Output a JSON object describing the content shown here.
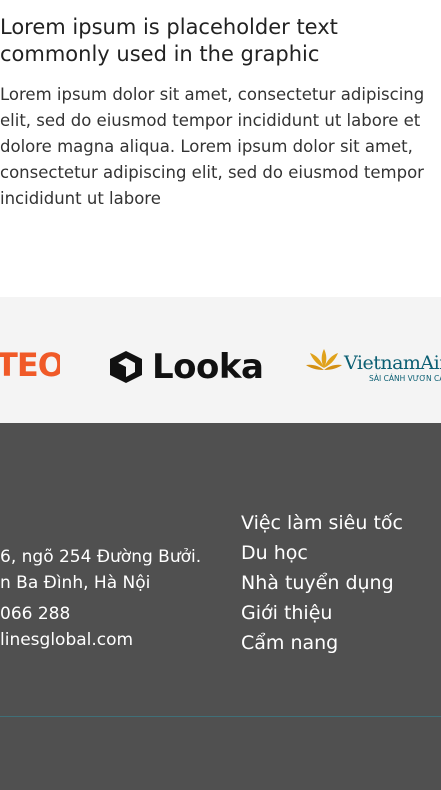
{
  "intro": {
    "title": "Lorem ipsum is placeholder text commonly used in the graphic",
    "body": "Lorem ipsum dolor sit amet, consectetur adipiscing elit, sed do eiusmod tempor incididunt ut labore et dolore magna aliqua. Lorem ipsum dolor sit amet, consectetur adipiscing elit, sed do eiusmod tempor incididunt ut labore"
  },
  "partners": {
    "logos": [
      {
        "name": "TEO",
        "text": "TEO",
        "color": "#f05a28"
      },
      {
        "name": "Looka",
        "text": "Looka",
        "color": "#111111"
      },
      {
        "name": "Vietnam Airlines",
        "text": "VietnamAirlines",
        "subtext": "SÀI CÁNH VƯƠN CAO",
        "color": "#0b5f73",
        "accent": "#e0a21b"
      }
    ]
  },
  "footer": {
    "contact": {
      "address_line1": "6, ngõ 254 Đường Bưởi.",
      "address_line2": "n Ba Đình, Hà Nội",
      "phone": "066 288",
      "email": "linesglobal.com"
    },
    "links": [
      {
        "label": "Việc làm siêu tốc"
      },
      {
        "label": "Du học"
      },
      {
        "label": "Nhà tuyển dụng"
      },
      {
        "label": "Giới thiệu"
      },
      {
        "label": "Cẩm nang"
      }
    ],
    "colors": {
      "background": "#505050",
      "divider": "#3f6f78",
      "text": "#ffffff"
    }
  }
}
